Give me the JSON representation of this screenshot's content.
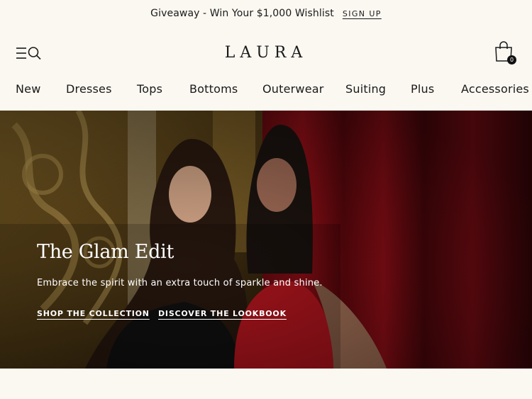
{
  "promo": {
    "text": "Giveaway - Win Your $1,000 Wishlist",
    "link": "SIGN UP"
  },
  "header": {
    "logo": "LAURA",
    "menu_icon": "hamburger-menu-icon",
    "search_icon": "search-icon",
    "bag_icon": "shopping-bag-icon",
    "bag_count": "0"
  },
  "nav": {
    "items": [
      "New",
      "Dresses",
      "Tops",
      "Bottoms",
      "Outerwear",
      "Suiting",
      "Plus",
      "Accessories"
    ]
  },
  "hero": {
    "title": "The Glam Edit",
    "subtitle": "Embrace the spirit with an extra touch of sparkle and shine.",
    "cta_primary": "SHOP THE COLLECTION",
    "cta_secondary": "DISCOVER THE LOOKBOOK"
  },
  "colors": {
    "background": "#fbf8f1",
    "text": "#1a1a1a",
    "hero_red": "#b3121c",
    "hero_gold": "#9b7a3a"
  }
}
